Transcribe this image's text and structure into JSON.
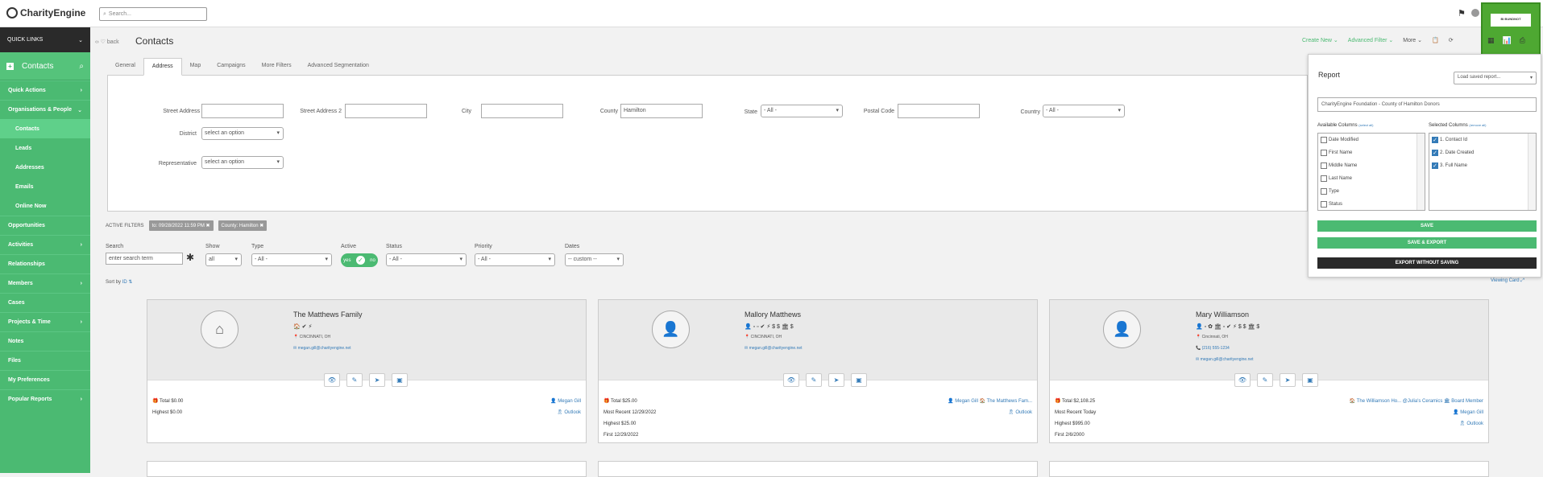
{
  "app": {
    "logo": "CharityEngine",
    "search_placeholder": "Search..."
  },
  "sidebar": {
    "quick_links": "QUICK LINKS",
    "section": "Contacts",
    "items": [
      {
        "label": "Quick Actions",
        "sub": false,
        "arrow": "›"
      },
      {
        "label": "Organisations & People",
        "sub": false,
        "arrow": "⌄"
      },
      {
        "label": "Contacts",
        "sub": true,
        "active": true
      },
      {
        "label": "Leads",
        "sub": true
      },
      {
        "label": "Addresses",
        "sub": true
      },
      {
        "label": "Emails",
        "sub": true
      },
      {
        "label": "Online Now",
        "sub": true
      },
      {
        "label": "Opportunities",
        "sub": false
      },
      {
        "label": "Activities",
        "sub": false,
        "arrow": "›"
      },
      {
        "label": "Relationships",
        "sub": false
      },
      {
        "label": "Members",
        "sub": false,
        "arrow": "›"
      },
      {
        "label": "Cases",
        "sub": false
      },
      {
        "label": "Projects & Time",
        "sub": false,
        "arrow": "›"
      },
      {
        "label": "Notes",
        "sub": false
      },
      {
        "label": "Files",
        "sub": false
      },
      {
        "label": "My Preferences",
        "sub": false
      },
      {
        "label": "Popular Reports",
        "sub": false,
        "arrow": "›"
      }
    ]
  },
  "header": {
    "back": "back",
    "title": "Contacts",
    "create_new": "Create New ⌄",
    "advanced_filter": "Advanced Filter ⌄",
    "more": "More ⌄",
    "highlight_label": "BI BUNDNOT"
  },
  "tabs": [
    "General",
    "Address",
    "Map",
    "Campaigns",
    "More Filters",
    "Advanced Segmentation"
  ],
  "address_filter": {
    "street1_label": "Street Address 1",
    "street2_label": "Street Address 2",
    "city_label": "City",
    "county_label": "County",
    "county_value": "Hamilton",
    "state_label": "State",
    "state_value": "- All -",
    "postal_label": "Postal Code",
    "country_label": "Country",
    "country_value": "- All -",
    "district_label": "District",
    "district_value": "select an option",
    "rep_label": "Representative",
    "rep_value": "select an option"
  },
  "active_filters": {
    "label": "ACTIVE FILTERS",
    "chips": [
      "to: 09/28/2022 11:59 PM ✖",
      "County: Hamilton ✖"
    ]
  },
  "search_row": {
    "search_label": "Search",
    "search_placeholder": "enter search term",
    "show_label": "Show",
    "show_value": "all",
    "type_label": "Type",
    "type_value": "- All -",
    "active_label": "Active",
    "active_yes": "yes",
    "active_no": "no",
    "status_label": "Status",
    "status_value": "- All -",
    "priority_label": "Priority",
    "priority_value": "- All -",
    "dates_label": "Dates",
    "dates_value": "-- custom --"
  },
  "sort": {
    "prefix": "Sort by",
    "field": "ID ⇅"
  },
  "viewing": "Viewing Card ⤢",
  "cards": [
    {
      "name": "The Matthews Family",
      "icon": "home-icon",
      "icons": "🏠 ✔ ⚡",
      "location": "CINCINNATI, OH",
      "lines": [
        "✉ megan.gill@charityengine.net"
      ],
      "stats": [
        "🎁 Total $0.00",
        "Highest $0.00"
      ],
      "right": [
        "👤 Megan Gill",
        "🎗 Outlook"
      ]
    },
    {
      "name": "Mallory Matthews",
      "icon": "person-icon",
      "icons": "👤 ▫ ▫ ✔ ⚡ $ $ 🏛 $",
      "location": "CINCINNATI, OH",
      "lines": [
        "✉ megan.gill@charityengine.net"
      ],
      "stats": [
        "🎁 Total $25.00",
        "Most Recent 12/29/2022",
        "Highest $25.00",
        "First 12/29/2022"
      ],
      "right": [
        "👤 Megan Gill 🏠 The Matthews Fam...",
        "🎗 Outlook"
      ]
    },
    {
      "name": "Mary Williamson",
      "icon": "person-icon",
      "icons": "👤 ▫ ✿ 🏛 ▫ ✔ ⚡ $ $ 🏛 $",
      "location": "Cincinnati, OH",
      "lines": [
        "📞 (216) 555-1234",
        "✉ megan.gill@charityengine.net"
      ],
      "stats": [
        "🎁 Total $2,108.25",
        "Most Recent Today",
        "Highest $995.00",
        "First 2/6/2000"
      ],
      "right": [
        "🏠 The Williamson Ho...     @Julia's Ceramics     🏛 Board Member",
        "👤 Megan Gill",
        "🎗 Outlook"
      ]
    }
  ],
  "report": {
    "title": "Report",
    "load_saved": "Load saved report...",
    "name": "CharityEngine Foundation - County of Hamilton Donors",
    "available_label": "Available Columns",
    "available_hint": "(select all)",
    "selected_label": "Selected Columns",
    "selected_hint": "(remove all)",
    "available": [
      "Date Modified",
      "First Name",
      "Middle Name",
      "Last Name",
      "Type",
      "Status"
    ],
    "selected": [
      "1. Contact Id",
      "2. Date Created",
      "3. Full Name"
    ],
    "save": "SAVE",
    "save_export": "SAVE & EXPORT",
    "export_no_save": "EXPORT WITHOUT SAVING"
  },
  "colors": {
    "green": "#4bba72",
    "dark": "#2a2a2a",
    "link": "#337ab7"
  }
}
